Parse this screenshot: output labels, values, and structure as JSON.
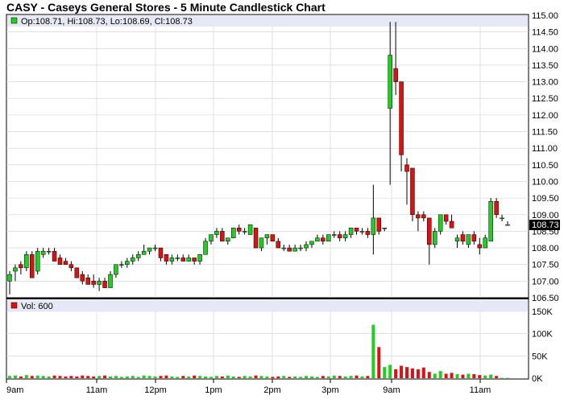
{
  "title": "CASY - Caseys General Stores - 5 Minute Candlestick Chart",
  "price_legend": "Op:108.71, Hi:108.73, Lo:108.69, Cl:108.73",
  "volume_legend": "Vol: 600",
  "last_price_label": "108.73",
  "colors": {
    "up": "#22cc22",
    "down": "#dd1111",
    "legend_bg": "#e6e9f5",
    "grid": "#cfcfcf",
    "last_price_bg": "#000000"
  },
  "chart_data": [
    {
      "type": "candlestick",
      "title": "CASY - Caseys General Stores - 5 Minute Candlestick Chart",
      "ylim": [
        106.5,
        115.0
      ],
      "y_ticks": [
        "115.00",
        "114.50",
        "114.00",
        "113.50",
        "113.00",
        "112.50",
        "112.00",
        "111.50",
        "111.00",
        "110.50",
        "110.00",
        "109.50",
        "109.00",
        "108.50",
        "108.00",
        "107.50",
        "107.00",
        "106.50"
      ],
      "x_ticks": [
        "9am",
        "11am",
        "12pm",
        "1pm",
        "2pm",
        "3pm",
        "9am",
        "11am"
      ],
      "last": 108.73,
      "candles": [
        [
          107.0,
          107.3,
          106.6,
          107.2
        ],
        [
          107.3,
          107.5,
          107.0,
          107.4
        ],
        [
          107.5,
          107.6,
          107.2,
          107.4
        ],
        [
          107.4,
          107.9,
          107.3,
          107.8
        ],
        [
          107.8,
          107.9,
          107.1,
          107.1
        ],
        [
          107.3,
          108.0,
          107.2,
          107.9
        ],
        [
          107.8,
          108.0,
          107.7,
          107.9
        ],
        [
          107.9,
          108.0,
          107.8,
          107.9
        ],
        [
          107.9,
          108.0,
          107.6,
          107.6
        ],
        [
          107.7,
          107.8,
          107.5,
          107.5
        ],
        [
          107.6,
          107.7,
          107.5,
          107.5
        ],
        [
          107.5,
          107.6,
          107.3,
          107.4
        ],
        [
          107.4,
          107.4,
          107.1,
          107.1
        ],
        [
          107.2,
          107.3,
          106.9,
          107.0
        ],
        [
          107.1,
          107.2,
          106.9,
          106.9
        ],
        [
          107.0,
          107.2,
          106.8,
          106.9
        ],
        [
          106.9,
          107.1,
          106.7,
          107.0
        ],
        [
          107.0,
          107.1,
          106.8,
          106.8
        ],
        [
          106.8,
          107.3,
          106.8,
          107.2
        ],
        [
          107.2,
          107.5,
          107.1,
          107.5
        ],
        [
          107.5,
          107.6,
          107.4,
          107.5
        ],
        [
          107.5,
          107.7,
          107.4,
          107.6
        ],
        [
          107.6,
          107.8,
          107.5,
          107.7
        ],
        [
          107.7,
          107.9,
          107.6,
          107.8
        ],
        [
          107.8,
          108.1,
          107.8,
          107.9
        ],
        [
          107.9,
          108.0,
          107.8,
          108.0
        ],
        [
          108.0,
          108.1,
          107.9,
          108.0
        ],
        [
          108.0,
          108.0,
          107.6,
          107.7
        ],
        [
          107.8,
          107.8,
          107.5,
          107.6
        ],
        [
          107.6,
          107.8,
          107.5,
          107.7
        ],
        [
          107.7,
          107.8,
          107.6,
          107.7
        ],
        [
          107.7,
          107.8,
          107.6,
          107.6
        ],
        [
          107.6,
          107.8,
          107.6,
          107.7
        ],
        [
          107.7,
          107.7,
          107.5,
          107.6
        ],
        [
          107.6,
          107.8,
          107.5,
          107.8
        ],
        [
          107.8,
          108.3,
          107.8,
          108.2
        ],
        [
          108.2,
          108.4,
          108.1,
          108.4
        ],
        [
          108.4,
          108.6,
          108.3,
          108.5
        ],
        [
          108.5,
          108.6,
          108.2,
          108.2
        ],
        [
          108.2,
          108.3,
          108.1,
          108.3
        ],
        [
          108.3,
          108.6,
          108.3,
          108.6
        ],
        [
          108.6,
          108.7,
          108.4,
          108.5
        ],
        [
          108.5,
          108.6,
          108.4,
          108.5
        ],
        [
          108.4,
          108.7,
          108.4,
          108.7
        ],
        [
          108.6,
          108.6,
          108.0,
          108.0
        ],
        [
          108.0,
          108.3,
          107.9,
          108.3
        ],
        [
          108.3,
          108.4,
          108.1,
          108.4
        ],
        [
          108.4,
          108.4,
          108.2,
          108.2
        ],
        [
          108.2,
          108.3,
          108.0,
          108.0
        ],
        [
          108.0,
          108.1,
          107.9,
          108.0
        ],
        [
          108.0,
          108.1,
          107.9,
          107.9
        ],
        [
          107.9,
          108.1,
          107.9,
          108.0
        ],
        [
          108.0,
          108.1,
          107.9,
          108.0
        ],
        [
          108.0,
          108.2,
          107.9,
          108.1
        ],
        [
          108.1,
          108.2,
          108.0,
          108.2
        ],
        [
          108.2,
          108.4,
          108.2,
          108.3
        ],
        [
          108.3,
          108.4,
          108.1,
          108.2
        ],
        [
          108.2,
          108.4,
          108.2,
          108.4
        ],
        [
          108.4,
          108.5,
          108.3,
          108.4
        ],
        [
          108.4,
          108.5,
          108.2,
          108.3
        ],
        [
          108.3,
          108.5,
          108.2,
          108.4
        ],
        [
          108.4,
          108.6,
          108.3,
          108.6
        ],
        [
          108.6,
          108.6,
          108.4,
          108.5
        ],
        [
          108.5,
          108.6,
          108.4,
          108.5
        ],
        [
          108.5,
          108.6,
          108.3,
          108.4
        ],
        [
          108.4,
          109.9,
          107.8,
          108.9
        ],
        [
          108.9,
          108.9,
          108.4,
          108.5
        ],
        [
          108.6,
          108.6,
          108.5,
          108.6
        ],
        [
          112.2,
          114.8,
          109.9,
          113.8
        ],
        [
          113.4,
          114.8,
          112.6,
          113.0
        ],
        [
          113.0,
          113.0,
          110.3,
          110.8
        ],
        [
          110.5,
          110.7,
          109.3,
          110.3
        ],
        [
          110.4,
          110.4,
          108.8,
          109.0
        ],
        [
          109.0,
          109.1,
          108.5,
          108.9
        ],
        [
          109.0,
          109.1,
          108.8,
          108.9
        ],
        [
          108.9,
          108.9,
          107.5,
          108.1
        ],
        [
          108.1,
          108.6,
          108.0,
          108.5
        ],
        [
          108.5,
          109.0,
          108.4,
          109.0
        ],
        [
          109.0,
          109.0,
          108.7,
          108.8
        ],
        [
          108.8,
          109.0,
          108.6,
          108.6
        ],
        [
          108.2,
          108.4,
          108.0,
          108.3
        ],
        [
          108.4,
          108.5,
          108.1,
          108.2
        ],
        [
          108.1,
          108.4,
          108.0,
          108.4
        ],
        [
          108.4,
          108.5,
          108.1,
          108.2
        ],
        [
          108.1,
          108.3,
          107.8,
          108.0
        ],
        [
          108.0,
          108.4,
          108.0,
          108.3
        ],
        [
          108.2,
          109.5,
          108.2,
          109.4
        ],
        [
          109.4,
          109.5,
          108.9,
          109.0
        ],
        [
          108.9,
          109.0,
          108.8,
          108.9
        ],
        [
          108.7,
          108.8,
          108.7,
          108.7
        ]
      ]
    },
    {
      "type": "bar",
      "title": "Vol: 600",
      "ylim": [
        0,
        150000
      ],
      "y_ticks": [
        "150K",
        "100K",
        "50K",
        "0K"
      ],
      "values": [
        5000,
        6000,
        4000,
        7000,
        5000,
        6000,
        5000,
        4000,
        6000,
        5000,
        4000,
        5000,
        4000,
        6000,
        5000,
        4000,
        5000,
        6000,
        4000,
        5000,
        3000,
        4000,
        5000,
        3000,
        6000,
        5000,
        4000,
        5000,
        6000,
        4000,
        3000,
        5000,
        4000,
        6000,
        5000,
        4000,
        3000,
        5000,
        4000,
        6000,
        4000,
        3000,
        5000,
        4000,
        6000,
        5000,
        4000,
        3000,
        4000,
        5000,
        3000,
        4000,
        3000,
        5000,
        4000,
        3000,
        5000,
        4000,
        6000,
        5000,
        4000,
        5000,
        6000,
        4000,
        5000,
        120000,
        70000,
        25000,
        30000,
        20000,
        28000,
        25000,
        22000,
        20000,
        24000,
        14000,
        10000,
        16000,
        10000,
        12000,
        9000,
        8000,
        10000,
        9000,
        7000,
        6000,
        8000,
        5000,
        600,
        600
      ]
    }
  ]
}
